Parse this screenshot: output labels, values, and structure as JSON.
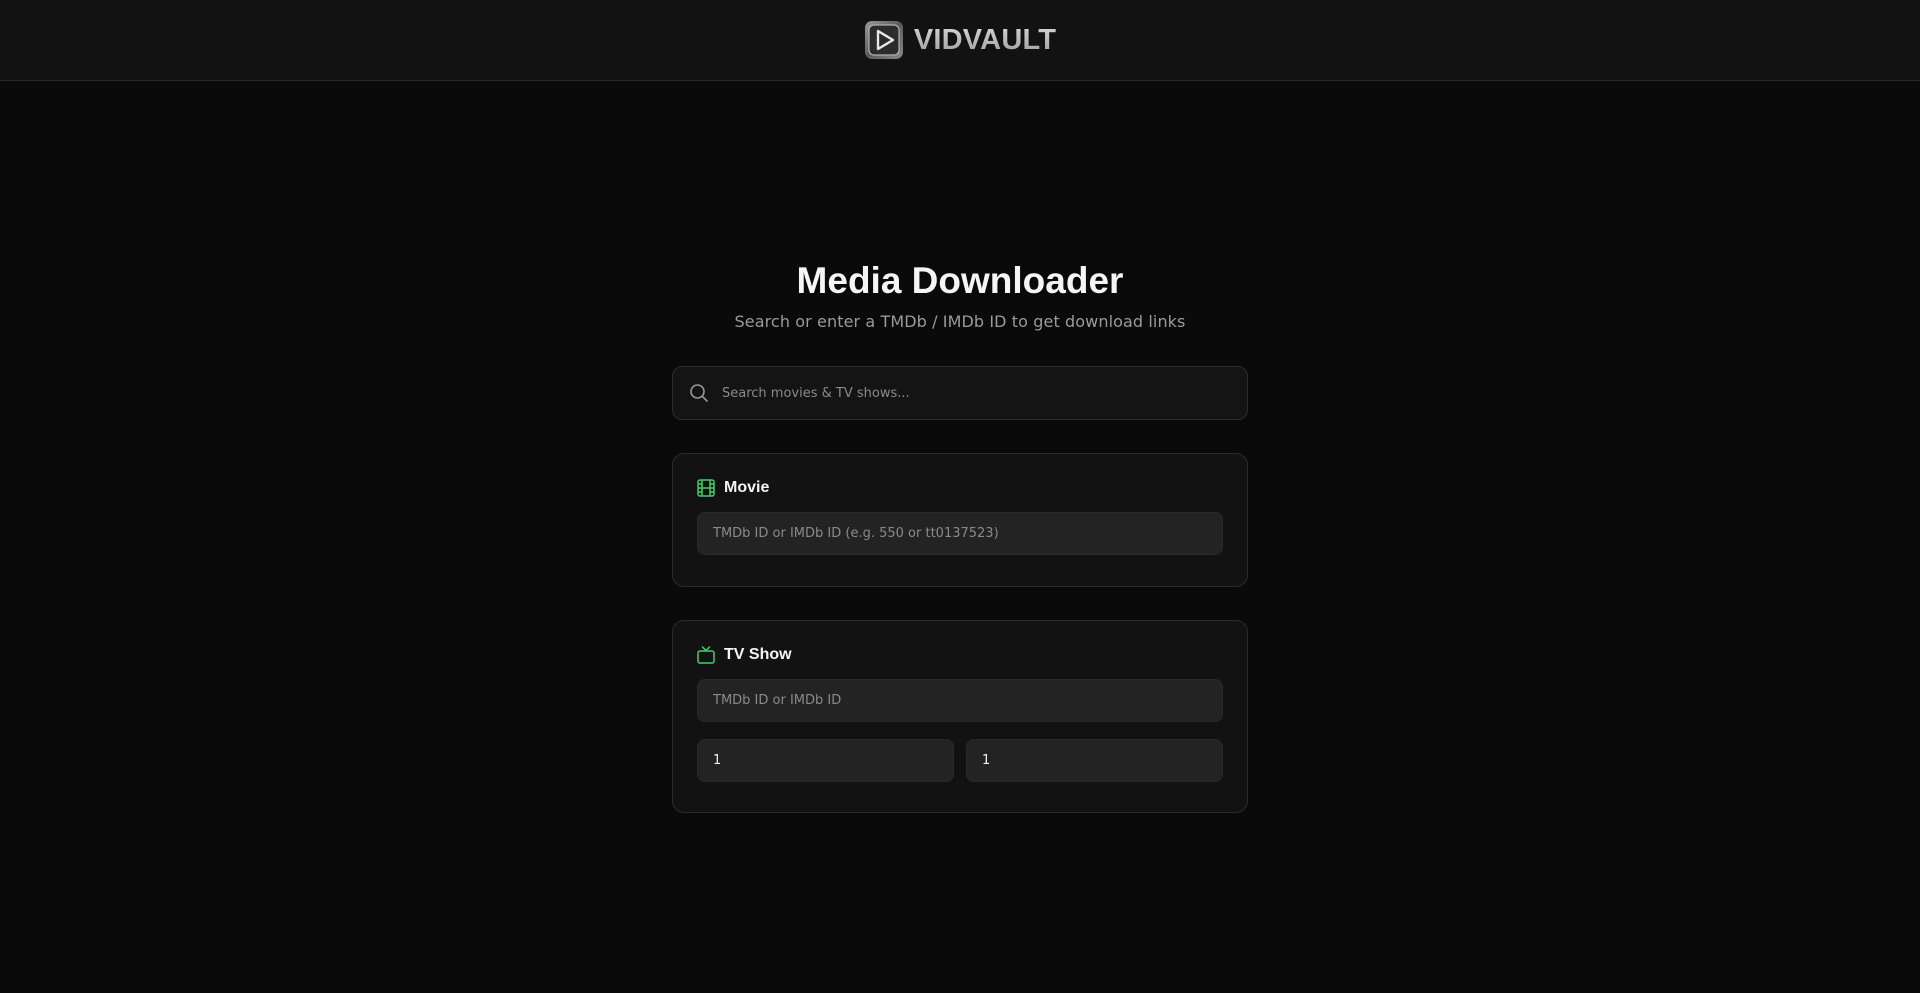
{
  "header": {
    "brand_name": "VIDVAULT",
    "logo_icon": "play-icon"
  },
  "main": {
    "title": "Media Downloader",
    "subtitle": "Search or enter a TMDb / IMDb ID to get download links"
  },
  "search": {
    "placeholder": "Search movies & TV shows...",
    "value": ""
  },
  "movie": {
    "title": "Movie",
    "icon": "film-icon",
    "id_placeholder": "TMDb ID or IMDb ID (e.g. 550 or tt0137523)",
    "id_value": ""
  },
  "tv": {
    "title": "TV Show",
    "icon": "tv-icon",
    "id_placeholder": "TMDb ID or IMDb ID",
    "id_value": "",
    "season_value": "1",
    "episode_value": "1"
  },
  "colors": {
    "background": "#0a0a0a",
    "card": "#121212",
    "accent_green": "#3ecf6a",
    "text_muted": "#9a9a9a"
  }
}
